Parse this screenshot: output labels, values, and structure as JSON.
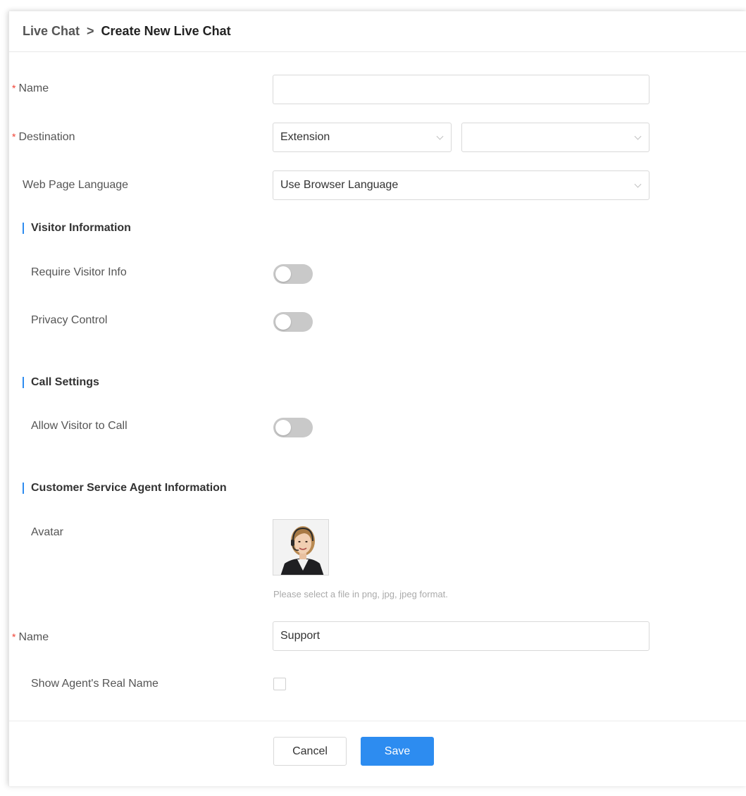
{
  "breadcrumb": {
    "parent": "Live Chat",
    "separator": ">",
    "current": "Create New Live Chat"
  },
  "form": {
    "required_mark": "*",
    "name_label": "Name",
    "name_value": "",
    "destination_label": "Destination",
    "destination_type": "Extension",
    "destination_value": "",
    "language_label": "Web Page Language",
    "language_value": "Use Browser Language"
  },
  "sections": {
    "visitor_info": "Visitor Information",
    "call_settings": "Call Settings",
    "agent_info": "Customer Service Agent Information"
  },
  "toggles": {
    "require_visitor_info_label": "Require Visitor Info",
    "require_visitor_info_on": false,
    "privacy_control_label": "Privacy Control",
    "privacy_control_on": false,
    "allow_visitor_call_label": "Allow Visitor to Call",
    "allow_visitor_call_on": false
  },
  "agent": {
    "avatar_label": "Avatar",
    "avatar_hint": "Please select a file in png, jpg, jpeg format.",
    "name_label": "Name",
    "name_value": "Support",
    "show_real_name_label": "Show Agent's Real Name",
    "show_real_name_checked": false
  },
  "buttons": {
    "cancel": "Cancel",
    "save": "Save"
  },
  "colors": {
    "accent": "#2d8cf0",
    "required": "#f04134",
    "toggle_off": "#c9c9c9"
  },
  "icons": {
    "select_arrow": "chevron-down-icon"
  }
}
